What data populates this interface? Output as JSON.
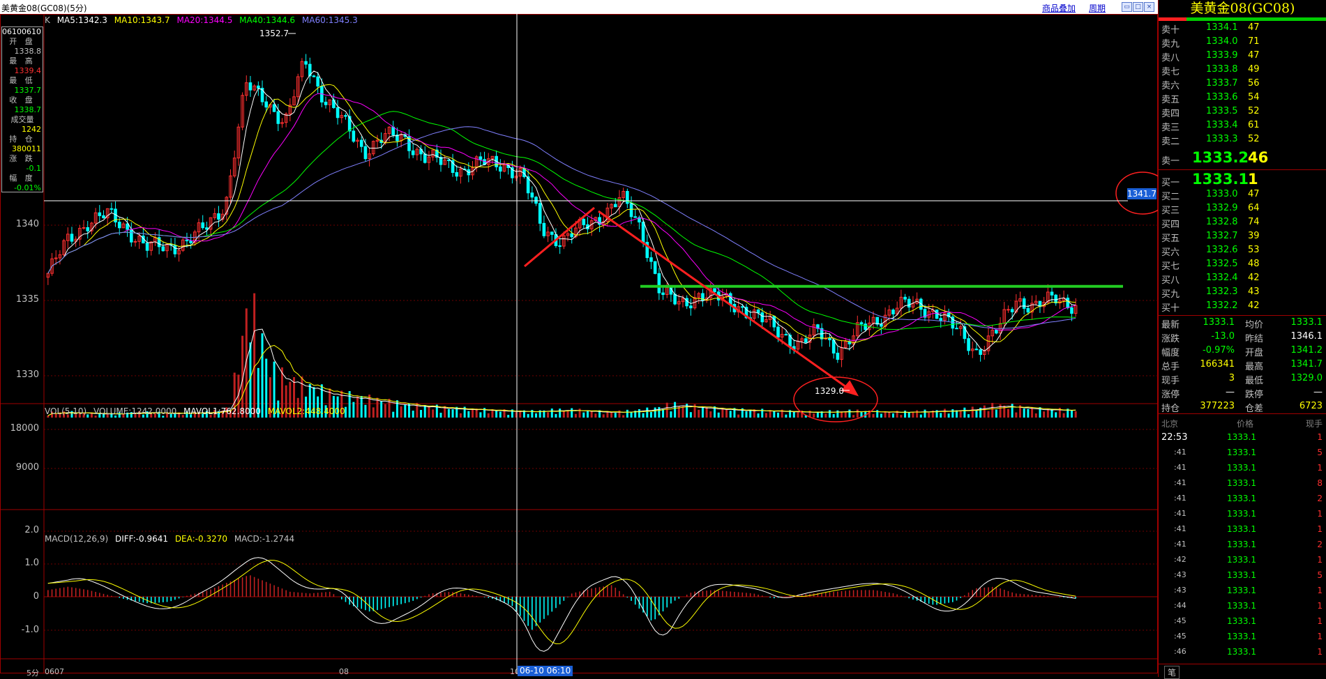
{
  "window": {
    "title": "美黄金08(GC08)(5分)",
    "link_overlay": "商品叠加",
    "link_period": "周期"
  },
  "colors": {
    "up": "#ff3030",
    "down": "#00ffff",
    "ma5": "#ffffff",
    "ma10": "#ffff00",
    "ma20": "#ff00ff",
    "ma40": "#00ff00",
    "ma60": "#8080ff",
    "frame": "#a00000"
  },
  "infobox": {
    "date": "06100610",
    "open_label": "开 盘",
    "open": "1338.8",
    "high_label": "最 高",
    "high": "1339.4",
    "low_label": "最 低",
    "low": "1337.7",
    "close_label": "收 盘",
    "close": "1338.7",
    "volume_label": "成交量",
    "volume": "1242",
    "oi_label": "持 仓",
    "oi": "380011",
    "change_label": "涨 跌",
    "change": "-0.1",
    "pct_label": "幅 度",
    "pct": "-0.01%"
  },
  "price_panel": {
    "legend_k": "K",
    "ma5": "MA5:1342.3",
    "ma10": "MA10:1343.7",
    "ma20": "MA20:1344.5",
    "ma40": "MA40:1344.6",
    "ma60": "MA60:1345.3",
    "y_ticks": [
      "1340",
      "1335",
      "1330"
    ],
    "high_marker": "1352.7",
    "low_marker": "1329.0",
    "crosshair_price": "1341.7"
  },
  "volume_panel": {
    "legend": "VOL(5,10)",
    "volume": "VOLUME:1242.0000",
    "mavol1": "MAVOL1:762.8000",
    "mavol2": "MAVOL2:448.4000",
    "y_ticks": [
      "18000",
      "9000"
    ]
  },
  "macd_panel": {
    "legend": "MACD(12,26,9)",
    "diff": "DIFF:-0.9641",
    "dea": "DEA:-0.3270",
    "macd": "MACD:-1.2744",
    "y_ticks": [
      "2.0",
      "1.0",
      "0",
      "-1.0"
    ]
  },
  "x_axis": {
    "period": "5分",
    "labels": [
      "0607",
      "08",
      "10"
    ],
    "crosshair_time": "06-10 06:10"
  },
  "chart_data": [
    {
      "type": "candlestick",
      "ylabel": "",
      "ylim": [
        1327,
        1355
      ],
      "overlays": [
        "MA5",
        "MA10",
        "MA20",
        "MA40",
        "MA60"
      ],
      "close_path": [
        1335.5,
        1338,
        1339.5,
        1340,
        1339,
        1337.5,
        1337.5,
        1338,
        1339,
        1341,
        1350,
        1349,
        1347,
        1352,
        1349,
        1347,
        1345,
        1346,
        1346,
        1344.5,
        1344,
        1343.5,
        1344,
        1344,
        1343,
        1339,
        1338,
        1339,
        1340,
        1341.3,
        1339,
        1334,
        1333,
        1334,
        1333.5,
        1333,
        1332,
        1331,
        1330,
        1331,
        1329.5,
        1331,
        1332,
        1333,
        1333,
        1332.5,
        1331,
        1329.5,
        1331,
        1333.5,
        1333,
        1333.5,
        1333.1
      ],
      "resistance_line": 1334.5
    },
    {
      "type": "bar",
      "ylabel": "",
      "ylim": [
        0,
        22000
      ],
      "values": [
        800,
        900,
        700,
        600,
        800,
        900,
        700,
        800,
        900,
        1500,
        19000,
        8000,
        6000,
        5000,
        4000,
        3500,
        3000,
        2500,
        2000,
        1800,
        1500,
        1400,
        1200,
        1100,
        1000,
        1200,
        1300,
        1000,
        900,
        1100,
        1400,
        2200,
        1800,
        1500,
        1300,
        1200,
        1100,
        1000,
        900,
        1000,
        1100,
        1000,
        900,
        1000,
        1100,
        1200,
        1500,
        2000,
        1800,
        1400,
        1300,
        1242
      ]
    },
    {
      "type": "bar",
      "ylabel": "",
      "ylim": [
        -2.2,
        2.4
      ],
      "values": [
        0.4,
        0.6,
        0.4,
        0.1,
        -0.2,
        -0.4,
        -0.3,
        0.1,
        0.4,
        0.9,
        1.3,
        0.8,
        0.3,
        0.2,
        0.3,
        -0.5,
        -0.9,
        -0.6,
        -0.3,
        0.2,
        0.3,
        0.1,
        -0.1,
        -0.5,
        -2.0,
        -0.9,
        0.2,
        0.5,
        0.7,
        -0.3,
        -1.5,
        -0.3,
        0.3,
        0.4,
        0.3,
        0.2,
        -0.1,
        0.1,
        0.2,
        0.3,
        0.4,
        0.4,
        0.2,
        -0.2,
        -0.5,
        -0.3,
        0.5,
        0.6,
        0.2,
        0.1,
        0.0,
        -0.1
      ]
    }
  ],
  "quote": {
    "title": "美黄金08(GC08)",
    "asks": [
      {
        "label": "卖十",
        "price": "1334.1",
        "vol": "47"
      },
      {
        "label": "卖九",
        "price": "1334.0",
        "vol": "71"
      },
      {
        "label": "卖八",
        "price": "1333.9",
        "vol": "47"
      },
      {
        "label": "卖七",
        "price": "1333.8",
        "vol": "49"
      },
      {
        "label": "卖六",
        "price": "1333.7",
        "vol": "56"
      },
      {
        "label": "卖五",
        "price": "1333.6",
        "vol": "54"
      },
      {
        "label": "卖四",
        "price": "1333.5",
        "vol": "52"
      },
      {
        "label": "卖三",
        "price": "1333.4",
        "vol": "61"
      },
      {
        "label": "卖二",
        "price": "1333.3",
        "vol": "52"
      },
      {
        "label": "卖一",
        "price": "1333.2",
        "vol": "46"
      }
    ],
    "bids": [
      {
        "label": "买一",
        "price": "1333.1",
        "vol": "1"
      },
      {
        "label": "买二",
        "price": "1333.0",
        "vol": "47"
      },
      {
        "label": "买三",
        "price": "1332.9",
        "vol": "64"
      },
      {
        "label": "买四",
        "price": "1332.8",
        "vol": "74"
      },
      {
        "label": "买五",
        "price": "1332.7",
        "vol": "39"
      },
      {
        "label": "买六",
        "price": "1332.6",
        "vol": "53"
      },
      {
        "label": "买七",
        "price": "1332.5",
        "vol": "48"
      },
      {
        "label": "买八",
        "price": "1332.4",
        "vol": "42"
      },
      {
        "label": "买九",
        "price": "1332.3",
        "vol": "43"
      },
      {
        "label": "买十",
        "price": "1332.2",
        "vol": "42"
      }
    ],
    "stats": [
      {
        "l1": "最新",
        "v1": "1333.1",
        "l2": "均价",
        "v2": "1333.1",
        "c1": "#00ff00",
        "c2": "#00ff00"
      },
      {
        "l1": "涨跌",
        "v1": "-13.0",
        "l2": "昨结",
        "v2": "1346.1",
        "c1": "#00ff00",
        "c2": "#ffffff"
      },
      {
        "l1": "幅度",
        "v1": "-0.97%",
        "l2": "开盘",
        "v2": "1341.2",
        "c1": "#00ff00",
        "c2": "#00ff00"
      },
      {
        "l1": "总手",
        "v1": "166341",
        "l2": "最高",
        "v2": "1341.7",
        "c1": "#ffff00",
        "c2": "#00ff00"
      },
      {
        "l1": "现手",
        "v1": "3",
        "l2": "最低",
        "v2": "1329.0",
        "c1": "#ffff00",
        "c2": "#00ff00"
      },
      {
        "l1": "涨停",
        "v1": "—",
        "l2": "跌停",
        "v2": "—",
        "c1": "#ffffff",
        "c2": "#ffffff"
      },
      {
        "l1": "持仓",
        "v1": "377223",
        "l2": "仓差",
        "v2": "6723",
        "c1": "#ffff00",
        "c2": "#ffff00"
      }
    ],
    "tick_header": {
      "time": "北京",
      "price": "价格",
      "vol": "现手"
    },
    "ticks": [
      {
        "time": "22:53",
        "price": "1333.1",
        "vol": "1"
      },
      {
        "time": ":41",
        "price": "1333.1",
        "vol": "5"
      },
      {
        "time": ":41",
        "price": "1333.1",
        "vol": "1"
      },
      {
        "time": ":41",
        "price": "1333.1",
        "vol": "8"
      },
      {
        "time": ":41",
        "price": "1333.1",
        "vol": "2"
      },
      {
        "time": ":41",
        "price": "1333.1",
        "vol": "1"
      },
      {
        "time": ":41",
        "price": "1333.1",
        "vol": "1"
      },
      {
        "time": ":41",
        "price": "1333.1",
        "vol": "2"
      },
      {
        "time": ":42",
        "price": "1333.1",
        "vol": "1"
      },
      {
        "time": ":43",
        "price": "1333.1",
        "vol": "5"
      },
      {
        "time": ":43",
        "price": "1333.1",
        "vol": "1"
      },
      {
        "time": ":44",
        "price": "1333.1",
        "vol": "1"
      },
      {
        "time": ":45",
        "price": "1333.1",
        "vol": "1"
      },
      {
        "time": ":45",
        "price": "1333.1",
        "vol": "1"
      },
      {
        "time": ":46",
        "price": "1333.1",
        "vol": "1"
      }
    ],
    "bottom_tab": "笔"
  }
}
